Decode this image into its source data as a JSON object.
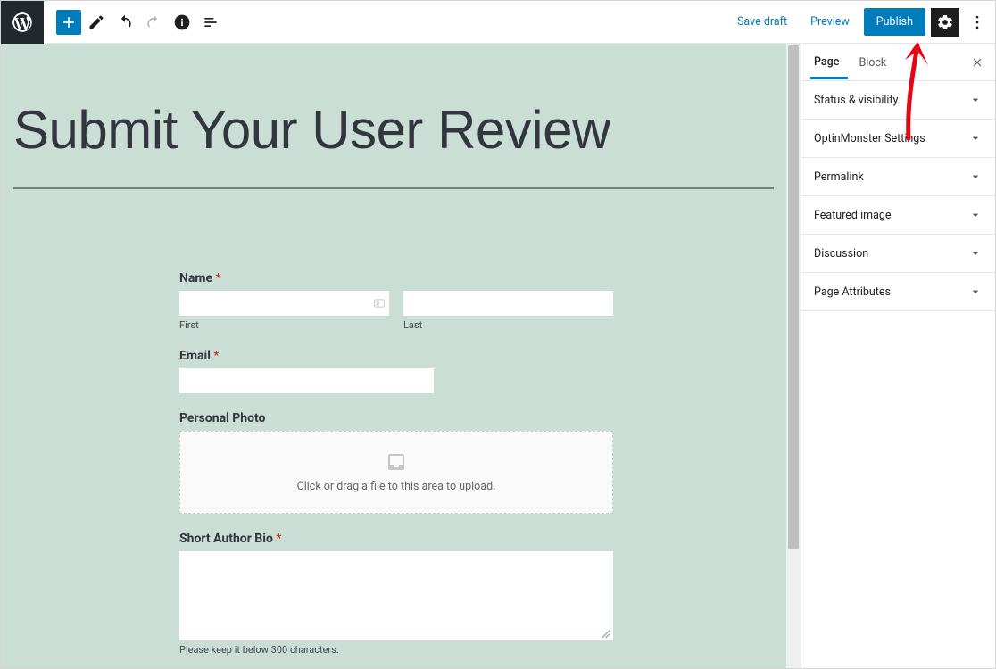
{
  "toolbar": {
    "save_draft": "Save draft",
    "preview": "Preview",
    "publish": "Publish"
  },
  "sidebar": {
    "tabs": {
      "page": "Page",
      "block": "Block"
    },
    "panels": {
      "status": "Status & visibility",
      "optin": "OptinMonster Settings",
      "permalink": "Permalink",
      "featured": "Featured image",
      "discussion": "Discussion",
      "attributes": "Page Attributes"
    }
  },
  "page": {
    "title": "Submit Your User Review"
  },
  "form": {
    "name": {
      "label": "Name",
      "first": "First",
      "last": "Last"
    },
    "email": {
      "label": "Email"
    },
    "photo": {
      "label": "Personal Photo",
      "hint": "Click or drag a file to this area to upload."
    },
    "bio": {
      "label": "Short Author Bio",
      "hint": "Please keep it below 300 characters."
    },
    "required_mark": "*"
  }
}
